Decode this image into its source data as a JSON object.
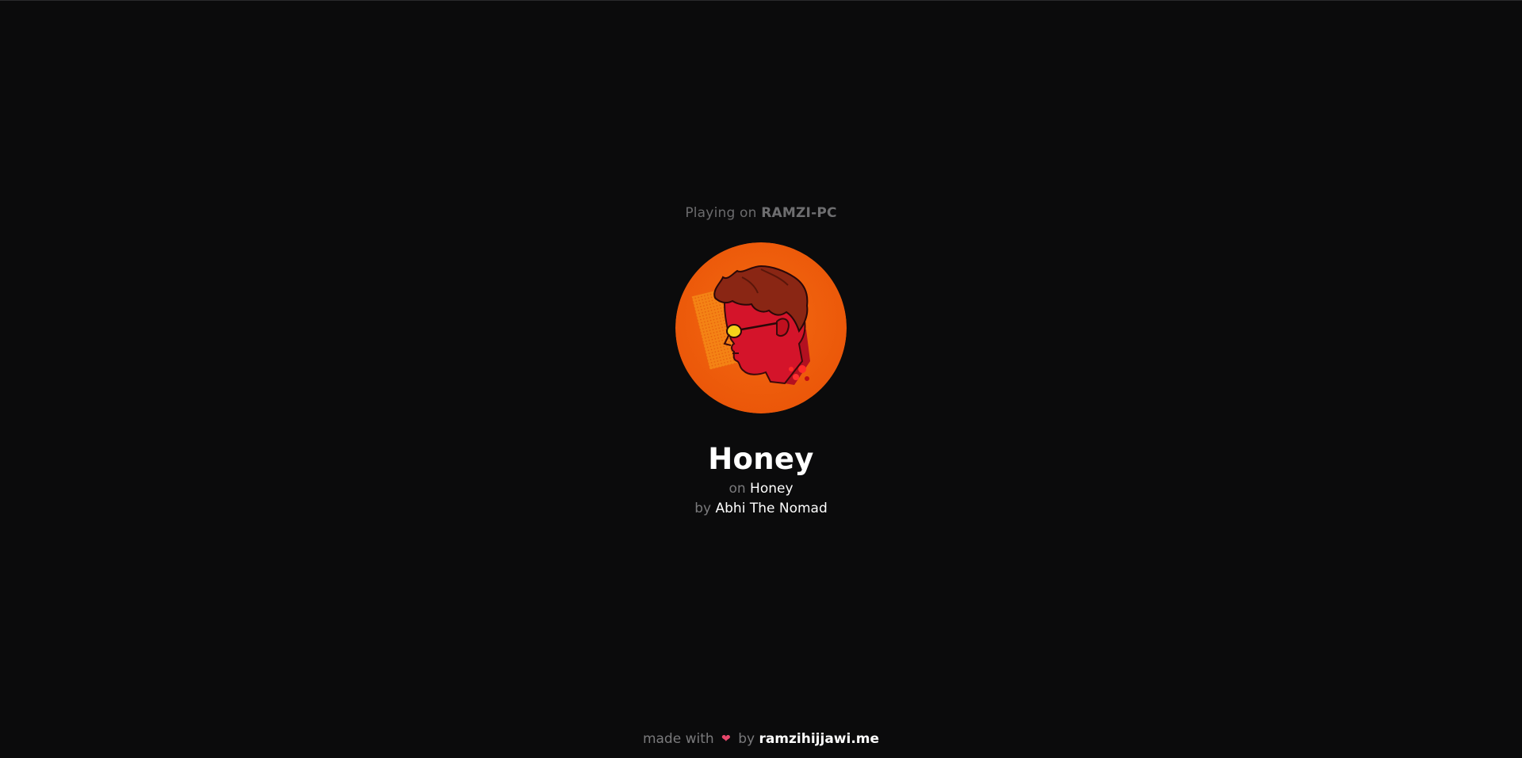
{
  "now_playing": {
    "prefix": "Playing on",
    "device": "RAMZI-PC"
  },
  "track": {
    "title": "Honey",
    "album_prefix": "on",
    "album": "Honey",
    "artist_prefix": "by",
    "artist": "Abhi The Nomad"
  },
  "footer": {
    "made_with": "made with",
    "heart_icon": "heart-icon",
    "by": "by",
    "site": "ramzihijjawi.me"
  },
  "colors": {
    "background": "#0b0b0c",
    "art_orange": "#f0620e",
    "art_red": "#d4142a"
  }
}
